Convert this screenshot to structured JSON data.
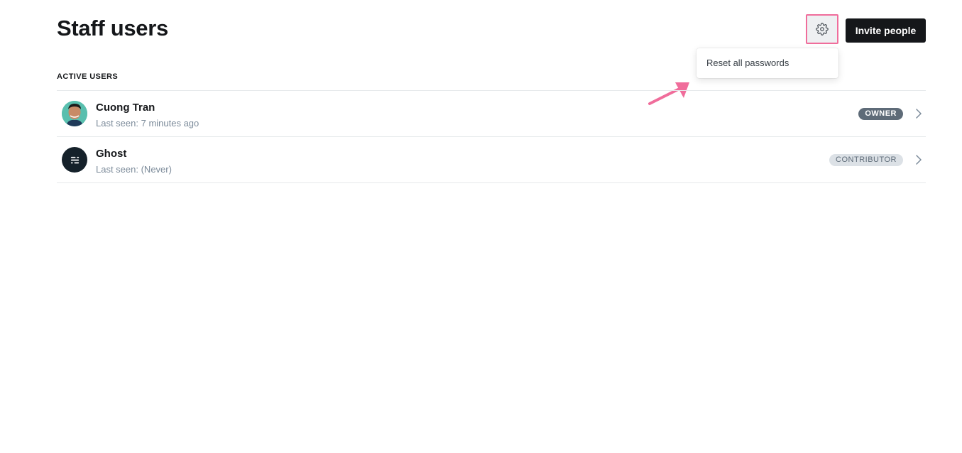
{
  "header": {
    "title": "Staff users",
    "settings_icon": "gear-icon",
    "invite_label": "Invite people"
  },
  "dropdown": {
    "items": [
      {
        "label": "Reset all passwords"
      }
    ]
  },
  "section": {
    "title": "ACTIVE USERS"
  },
  "users": [
    {
      "name": "Cuong Tran",
      "last_seen": "Last seen: 7 minutes ago",
      "role": "OWNER",
      "avatar": "photo"
    },
    {
      "name": "Ghost",
      "last_seen": "Last seen: (Never)",
      "role": "CONTRIBUTOR",
      "avatar": "ghost-logo"
    }
  ],
  "colors": {
    "annotation_accent": "#f06d9b",
    "primary_button": "#15171a",
    "owner_badge": "#5e6b78",
    "contributor_badge": "#dce1e6"
  }
}
